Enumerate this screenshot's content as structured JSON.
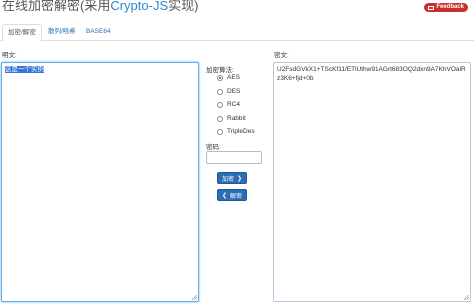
{
  "header": {
    "title_prefix": "在线加密解密(采用",
    "title_brand": "Crypto-JS",
    "title_suffix": "实现)",
    "feedback_label": "Feedback"
  },
  "tabs": [
    {
      "label": "加密/解密",
      "active": true
    },
    {
      "label": "散列/哈希",
      "active": false
    },
    {
      "label": "BASE64",
      "active": false
    }
  ],
  "plaintext": {
    "label": "明文:",
    "value": "这是一个实例"
  },
  "algorithm": {
    "label": "加密算法:",
    "options": [
      "AES",
      "DES",
      "RC4",
      "Rabbit",
      "TripleDes"
    ],
    "selected": "AES"
  },
  "password": {
    "label": "密码:",
    "value": ""
  },
  "buttons": {
    "encrypt_label": "加密",
    "decrypt_label": "解密"
  },
  "ciphertext": {
    "label": "密文:",
    "value": "U2FsdGVkX1+TScKf11/ETlUthw91AGrt683OQ2dxn9A7KhVOalRz3K6+fjd+0b"
  },
  "colors": {
    "brand": "#2a8ad0",
    "button": "#2d6db5",
    "feedback": "#c9302c"
  }
}
